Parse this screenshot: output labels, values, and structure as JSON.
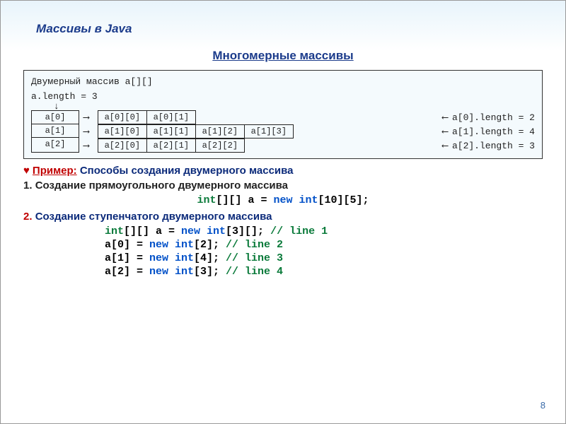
{
  "header": "Массивы в Java",
  "subtitle": "Многомерные массивы",
  "diagram": {
    "title": "Двумерный массив a[][]",
    "length_line": "a.length = 3",
    "rows": [
      {
        "left": "a[0]",
        "cells": [
          "a[0][0]",
          "a[0][1]"
        ],
        "right": "a[0].length = 2"
      },
      {
        "left": "a[1]",
        "cells": [
          "a[1][0]",
          "a[1][1]",
          "a[1][2]",
          "a[1][3]"
        ],
        "right": "a[1].length = 4"
      },
      {
        "left": "a[2]",
        "cells": [
          "a[2][0]",
          "a[2][1]",
          "a[2][2]"
        ],
        "right": "a[2].length = 3"
      }
    ]
  },
  "example_label": "Пример:",
  "example_text": "Способы создания двумерного массива",
  "step1_num": "1.",
  "step1_text": "Создание прямоугольного двумерного массива",
  "code1": {
    "type": "int",
    "decl": "[][] a = ",
    "kw": "new int",
    "tail": "[10][5];"
  },
  "step2_num": "2.",
  "step2_text": "Создание ступенчатого двумерного массива",
  "code2": [
    {
      "pre_type": "int",
      "pre_rest": "[][] a = ",
      "kw": "new int",
      "mid": "[3][]; ",
      "comment": "// line 1"
    },
    {
      "pre_type": "",
      "pre_rest": "a[0] = ",
      "kw": "new int",
      "mid": "[2]; ",
      "comment": "// line 2"
    },
    {
      "pre_type": "",
      "pre_rest": "a[1] = ",
      "kw": "new int",
      "mid": "[4]; ",
      "comment": "// line 3"
    },
    {
      "pre_type": "",
      "pre_rest": "a[2] = ",
      "kw": "new int",
      "mid": "[3]; ",
      "comment": "// line 4"
    }
  ],
  "page_number": "8"
}
